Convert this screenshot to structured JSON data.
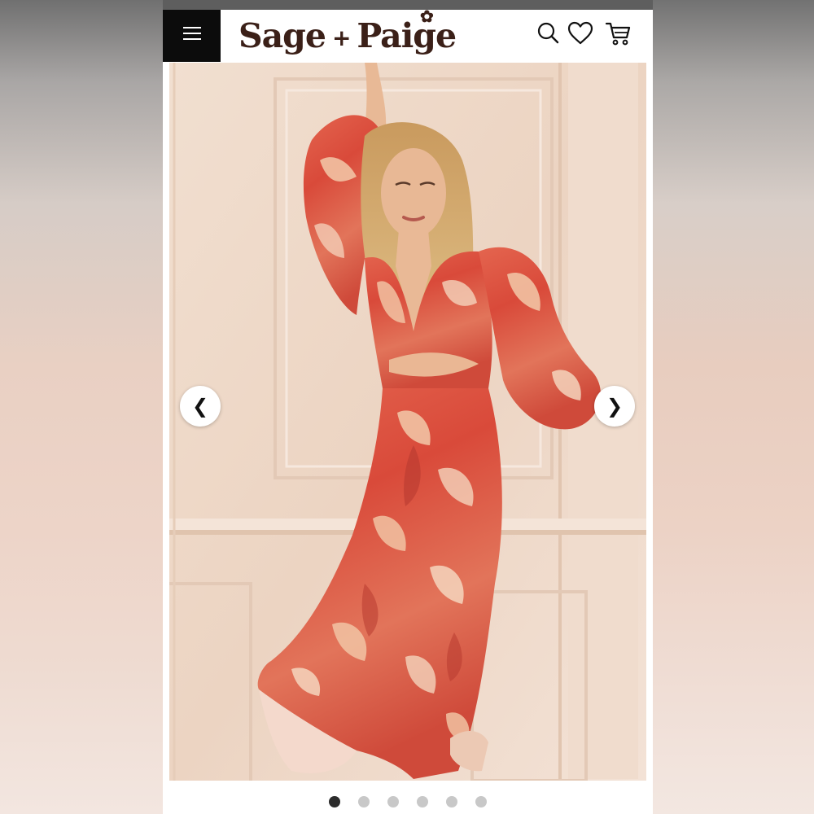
{
  "header": {
    "logo_left": "Sage",
    "logo_plus": "+",
    "logo_right": "Paige",
    "icons": [
      "menu-icon",
      "search-icon",
      "heart-icon",
      "cart-icon"
    ]
  },
  "carousel": {
    "prev_label": "❮",
    "next_label": "❯",
    "slide_count": 6,
    "active_slide": 1
  },
  "colors": {
    "header_menu_bg": "#0c0c0c",
    "logo": "#3b2018",
    "dot_active": "#2c2c2c",
    "dot_inactive": "#c8c8c8",
    "dress_primary": "#d94a3a",
    "dress_secondary": "#f2c9a9"
  }
}
